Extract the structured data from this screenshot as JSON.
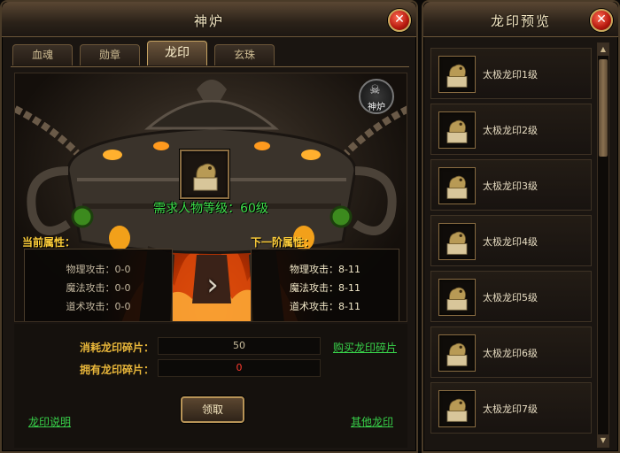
{
  "left_window": {
    "title": "神炉",
    "close": "✕",
    "tabs": [
      {
        "label": "血魂",
        "active": false
      },
      {
        "label": "勋章",
        "active": false
      },
      {
        "label": "龙印",
        "active": true
      },
      {
        "label": "玄珠",
        "active": false
      }
    ],
    "badge_label": "神炉",
    "requirement_text": "需求人物等级：60级",
    "current": {
      "heading": "当前属性：",
      "rows": [
        "物理攻击：0-0",
        "魔法攻击：0-0",
        "道术攻击：0-0"
      ]
    },
    "next": {
      "heading": "下一阶属性：",
      "rows": [
        "物理攻击：8-11",
        "魔法攻击：8-11",
        "道术攻击：8-11"
      ]
    },
    "consume": {
      "label": "消耗龙印碎片：",
      "value": "50"
    },
    "owned": {
      "label": "拥有龙印碎片：",
      "value": "0"
    },
    "buy_link": "购买龙印碎片",
    "claim_button": "领取",
    "explain_link": "龙印说明",
    "other_link": "其他龙印",
    "colors": {
      "accent_gold": "#e9b73a",
      "link_green": "#38d24a",
      "owned_red": "#ff3b2f"
    }
  },
  "right_window": {
    "title": "龙印预览",
    "close": "✕",
    "items": [
      "太极龙印1级",
      "太极龙印2级",
      "太极龙印3级",
      "太极龙印4级",
      "太极龙印5级",
      "太极龙印6级",
      "太极龙印7级"
    ]
  }
}
